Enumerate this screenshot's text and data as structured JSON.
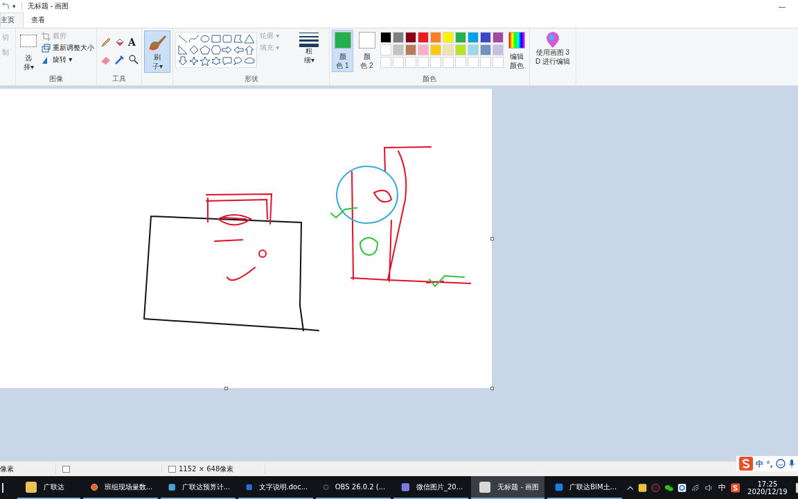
{
  "window": {
    "title": "无标题 - 画图",
    "qa_caret": "▾",
    "minimize": "—"
  },
  "tabs": [
    {
      "label": "主页",
      "selected": true
    },
    {
      "label": "查看",
      "selected": false
    }
  ],
  "clipboard": [
    {
      "label": "切",
      "disabled": true
    },
    {
      "label": "制",
      "disabled": true
    }
  ],
  "image": {
    "select": "选择▾",
    "items": [
      {
        "label": "裁剪",
        "disabled": true
      },
      {
        "label": "重新调整大小",
        "disabled": false
      },
      {
        "label": "旋转 ▾",
        "disabled": false
      }
    ],
    "group": "图像"
  },
  "tools": {
    "group": "工具",
    "text_glyph": "A"
  },
  "brush": {
    "label": "刷子▾",
    "selected": true
  },
  "shapes": {
    "group": "形状",
    "options": [
      {
        "label": "轮廓 ▾",
        "disabled": true
      },
      {
        "label": "填充 ▾",
        "disabled": true
      }
    ]
  },
  "thickness": {
    "label": "粗细▾"
  },
  "colors": {
    "group": "颜色",
    "slots": [
      {
        "label": "颜色 1",
        "color": "#22b14c",
        "selected": true
      },
      {
        "label": "颜色 2",
        "color": "#ffffff",
        "selected": false
      }
    ],
    "palette": [
      {
        "color": "#000000"
      },
      {
        "color": "#7f7f7f"
      },
      {
        "color": "#880015"
      },
      {
        "color": "#ed1c24"
      },
      {
        "color": "#ff7f27"
      },
      {
        "color": "#fff200"
      },
      {
        "color": "#22b14c"
      },
      {
        "color": "#00a2e8"
      },
      {
        "color": "#3f48cc"
      },
      {
        "color": "#a349a4"
      },
      {
        "color": "#ffffff"
      },
      {
        "color": "#c3c3c3"
      },
      {
        "color": "#b97a57"
      },
      {
        "color": "#ffaec9"
      },
      {
        "color": "#ffc90e"
      },
      {
        "color": "#efe4b0"
      },
      {
        "color": "#b5e61d"
      },
      {
        "color": "#99d9ea"
      },
      {
        "color": "#7092be"
      },
      {
        "color": "#c8bfe7"
      },
      {
        "color": "#ffffff"
      },
      {
        "color": "#ffffff"
      },
      {
        "color": "#ffffff"
      },
      {
        "color": "#ffffff"
      },
      {
        "color": "#ffffff"
      },
      {
        "color": "#ffffff"
      },
      {
        "color": "#ffffff"
      },
      {
        "color": "#ffffff"
      },
      {
        "color": "#ffffff"
      },
      {
        "color": "#ffffff"
      }
    ],
    "edit": "编辑颜色"
  },
  "paint3d": {
    "label": "使用画图 3D 进行编辑"
  },
  "status_bar": {
    "cursor": "像素",
    "size": "1152 × 648像素"
  },
  "ime": {
    "mode": "中",
    "punct": "°,"
  },
  "taskbar": {
    "items": [
      {
        "label": "广联达",
        "selected": false
      },
      {
        "label": "班组现场量数...",
        "selected": false
      },
      {
        "label": "广联达预算计...",
        "selected": false
      },
      {
        "label": "文字说明.doc...",
        "selected": false
      },
      {
        "label": "OBS 26.0.2 (...",
        "selected": false
      },
      {
        "label": "微信图片_20...",
        "selected": false
      },
      {
        "label": "无标题 - 画图",
        "selected": true
      },
      {
        "label": "广联达BIM土...",
        "selected": false
      }
    ],
    "tray_ime": "中",
    "time": "17:25",
    "date": "2020/12/19"
  }
}
